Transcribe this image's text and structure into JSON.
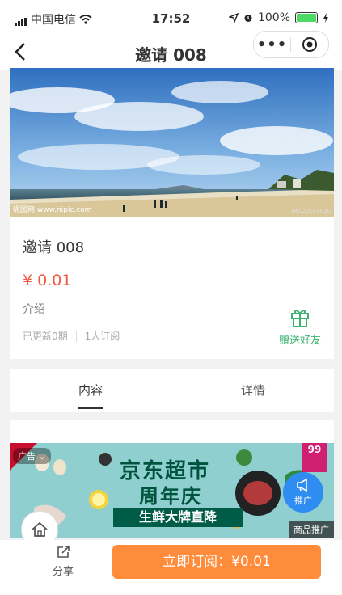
{
  "status": {
    "carrier": "中国电信",
    "time": "17:52",
    "battery": "100%"
  },
  "nav": {
    "title": "邀请  008",
    "back_icon": "chevron-left-icon",
    "more_label": "•••"
  },
  "banner": {
    "watermark_left": "昵图网 www.nipic.com",
    "watermark_right": "NO.20101010"
  },
  "product": {
    "title": "邀请 008",
    "price": "¥ 0.01",
    "intro_label": "介绍",
    "updated": "已更新0期",
    "subscribers": "1人订阅",
    "gift_label": "赠送好友"
  },
  "tabs": [
    {
      "label": "内容"
    },
    {
      "label": "详情"
    }
  ],
  "ad": {
    "tag": "广告",
    "line1": "京东超市",
    "line2": "周年庆",
    "band": "生鲜大牌直降",
    "badge": "99",
    "footer": "商品推广",
    "promote": "推广"
  },
  "bottom": {
    "share_label": "分享",
    "subscribe_label": "立即订阅：¥0.01"
  },
  "colors": {
    "price": "#f05a40",
    "gift": "#3cb371",
    "subscribe": "#ff8c3a",
    "promote": "#2f8cf0"
  }
}
